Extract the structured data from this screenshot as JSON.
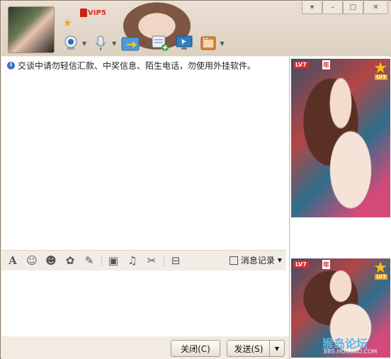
{
  "titlebar": {
    "vip_label": "VIP5",
    "window_buttons": [
      "▾",
      "–",
      "□",
      "✕"
    ]
  },
  "toolbar": {
    "icons": [
      "webcam-icon",
      "microphone-icon",
      "file-transfer-icon",
      "add-chat-icon",
      "remote-desktop-icon",
      "apps-icon"
    ],
    "has_dropdown": [
      true,
      true,
      true,
      false,
      false,
      true
    ]
  },
  "chat": {
    "notice": "交谈中请勿轻信汇款、中奖信息、陌生电话，勿使用外挂软件。"
  },
  "format_bar": {
    "history_label": "消息记录"
  },
  "buttons": {
    "close_label": "关闭(C)",
    "send_label": "发送(S)"
  },
  "sidebar": {
    "level_badge": "LV7",
    "year_badge": "年",
    "level3_badge": "LV3",
    "watermark": "猴岛论坛",
    "watermark_url": "BBS.HOUDAO.COM"
  }
}
